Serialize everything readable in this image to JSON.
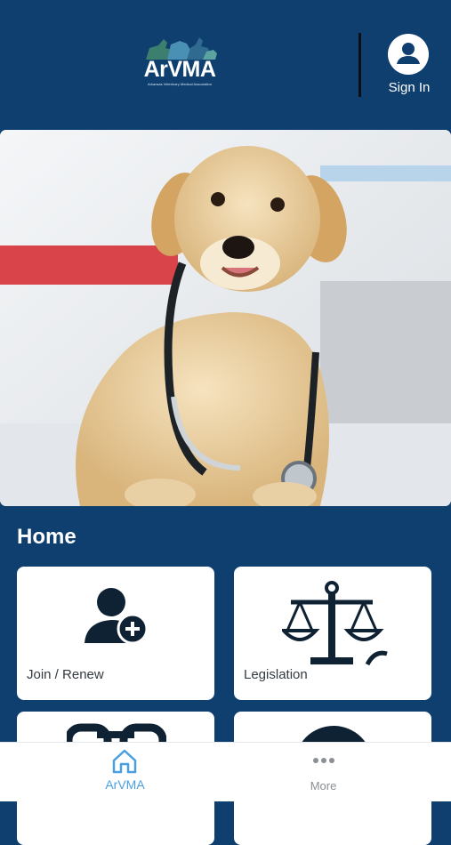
{
  "header": {
    "logo_text": "ArVMA",
    "logo_subtitle": "Arkansas Veterinary Medical Association",
    "sign_in_label": "Sign In",
    "background_color": "#0f3f6f"
  },
  "hero": {
    "icon": "puppy-with-stethoscope-photo"
  },
  "home": {
    "title": "Home",
    "tiles": [
      {
        "label": "Join / Renew",
        "icon": "user-add-icon"
      },
      {
        "label": "Legislation",
        "icon": "scales-of-justice-icon"
      },
      {
        "label": "",
        "icon": "link-icon"
      },
      {
        "label": "",
        "icon": "circle-icon"
      }
    ]
  },
  "tabbar": {
    "tabs": [
      {
        "label": "ArVMA",
        "icon": "home-icon",
        "active": true,
        "color": "#4a9fe0"
      },
      {
        "label": "More",
        "icon": "more-dots-icon",
        "active": false,
        "color": "#8a8f95"
      }
    ]
  }
}
